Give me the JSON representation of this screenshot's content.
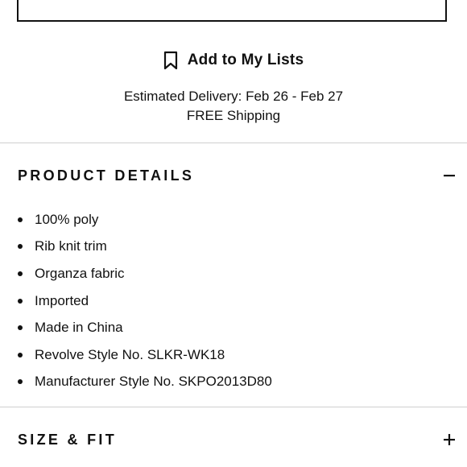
{
  "add_to_lists": {
    "label": "Add to My Lists",
    "icon": "bookmark-icon"
  },
  "delivery": {
    "estimate": "Estimated Delivery: Feb 26 - Feb 27",
    "shipping": "FREE Shipping"
  },
  "product_details": {
    "title": "PRODUCT DETAILS",
    "toggle_icon": "minus-icon",
    "expanded": true,
    "items": [
      "100% poly",
      "Rib knit trim",
      "Organza fabric",
      "Imported",
      "Made in China",
      "Revolve Style No. SLKR-WK18",
      "Manufacturer Style No. SKPO2013D80"
    ]
  },
  "size_fit": {
    "title": "SIZE & FIT",
    "toggle_icon": "plus-icon",
    "expanded": false
  },
  "colors": {
    "text": "#111111",
    "divider": "#cfcfcf",
    "background": "#ffffff"
  }
}
